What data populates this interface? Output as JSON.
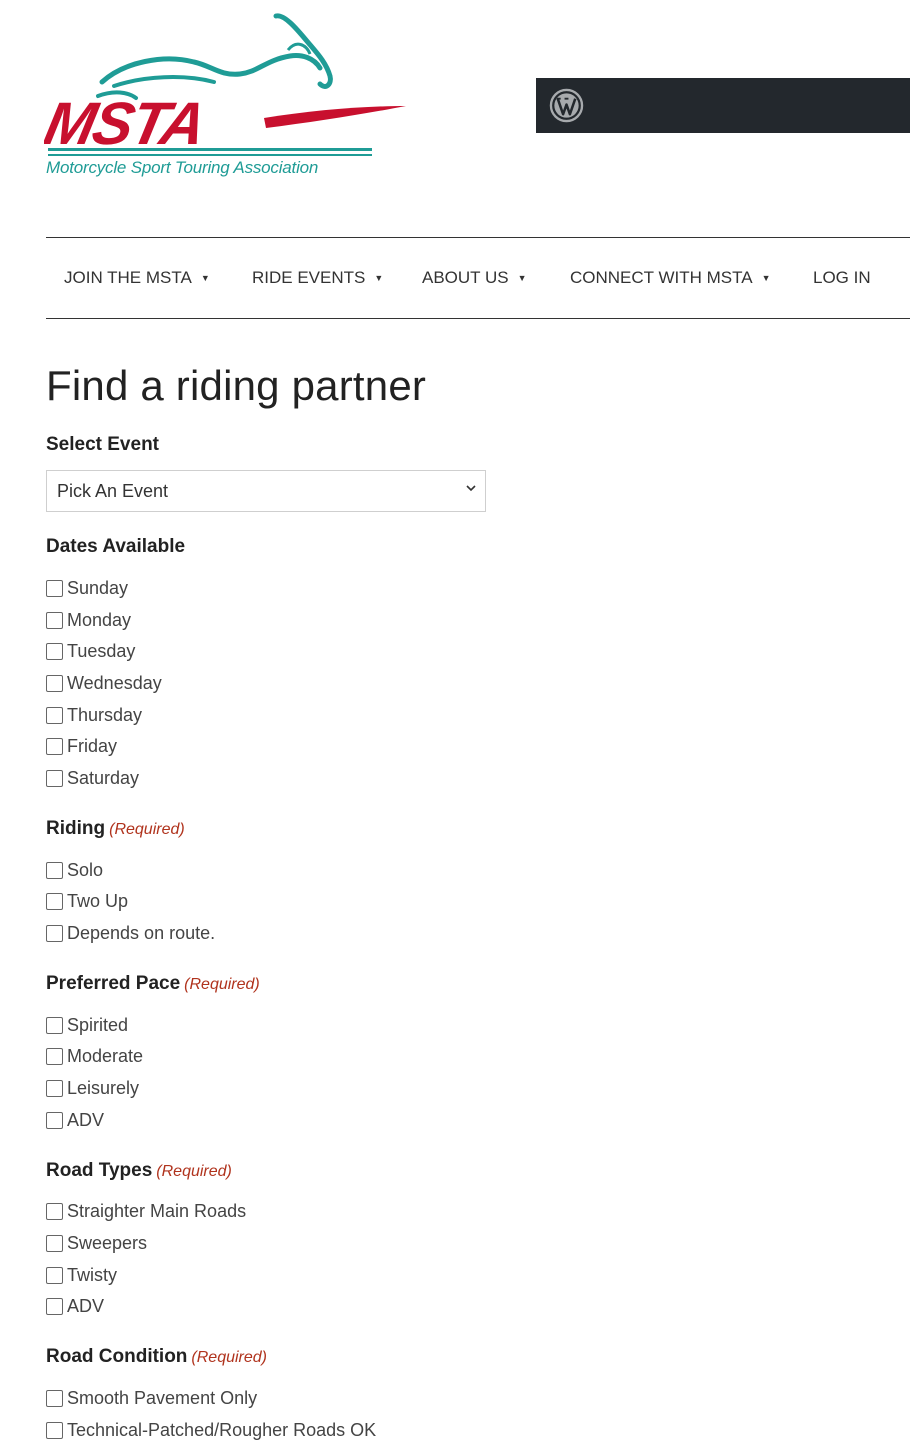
{
  "logo": {
    "wordmark": "MSTA",
    "tagline": "Motorcycle Sport Touring Association"
  },
  "adminbar": {
    "icon": "wordpress-icon"
  },
  "nav": {
    "items": [
      {
        "label": "JOIN THE MSTA",
        "dropdown": true
      },
      {
        "label": "RIDE EVENTS",
        "dropdown": true
      },
      {
        "label": "ABOUT US",
        "dropdown": true
      },
      {
        "label": "CONNECT WITH MSTA",
        "dropdown": true
      },
      {
        "label": "LOG IN",
        "dropdown": false
      }
    ]
  },
  "page": {
    "title": "Find a riding partner"
  },
  "form": {
    "event": {
      "label": "Select Event",
      "selected": "Pick An Event"
    },
    "dates": {
      "label": "Dates Available",
      "options": [
        "Sunday",
        "Monday",
        "Tuesday",
        "Wednesday",
        "Thursday",
        "Friday",
        "Saturday"
      ]
    },
    "riding": {
      "label": "Riding",
      "required": "(Required)",
      "options": [
        "Solo",
        "Two Up",
        "Depends on route."
      ]
    },
    "pace": {
      "label": "Preferred Pace",
      "required": "(Required)",
      "options": [
        "Spirited",
        "Moderate",
        "Leisurely",
        "ADV"
      ]
    },
    "road_types": {
      "label": "Road Types",
      "required": "(Required)",
      "options": [
        "Straighter Main Roads",
        "Sweepers",
        "Twisty",
        "ADV"
      ]
    },
    "road_condition": {
      "label": "Road Condition",
      "required": "(Required)",
      "options": [
        "Smooth Pavement Only",
        "Technical-Patched/Rougher Roads OK"
      ]
    }
  },
  "colors": {
    "brand_red": "#c8102e",
    "brand_teal": "#1f9c96",
    "required_red": "#b0331d",
    "admin_bar": "#23282d"
  }
}
